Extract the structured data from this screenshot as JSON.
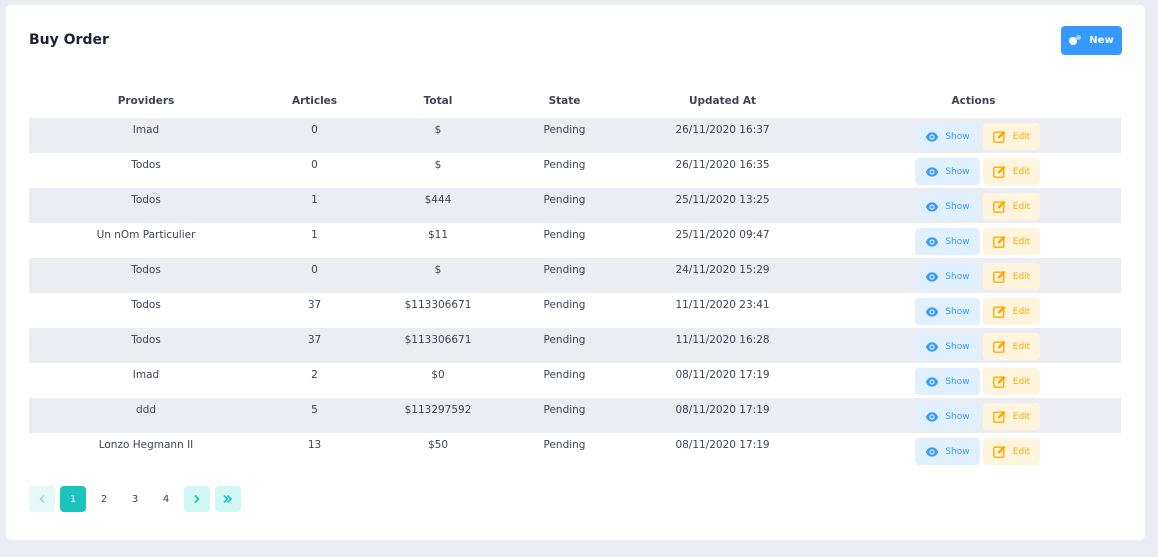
{
  "card": {
    "title": "Buy Order",
    "new_button_label": "New"
  },
  "table": {
    "headers": [
      "Providers",
      "Articles",
      "Total",
      "State",
      "Updated At",
      "Actions"
    ],
    "rows": [
      {
        "provider": "Imad",
        "articles": "0",
        "total": "$",
        "state": "Pending",
        "updated_at": "26/11/2020 16:37"
      },
      {
        "provider": "Todos",
        "articles": "0",
        "total": "$",
        "state": "Pending",
        "updated_at": "26/11/2020 16:35"
      },
      {
        "provider": "Todos",
        "articles": "1",
        "total": "$444",
        "state": "Pending",
        "updated_at": "25/11/2020 13:25"
      },
      {
        "provider": "Un nOm Particulier",
        "articles": "1",
        "total": "$11",
        "state": "Pending",
        "updated_at": "25/11/2020 09:47"
      },
      {
        "provider": "Todos",
        "articles": "0",
        "total": "$",
        "state": "Pending",
        "updated_at": "24/11/2020 15:29"
      },
      {
        "provider": "Todos",
        "articles": "37",
        "total": "$113306671",
        "state": "Pending",
        "updated_at": "11/11/2020 23:41"
      },
      {
        "provider": "Todos",
        "articles": "37",
        "total": "$113306671",
        "state": "Pending",
        "updated_at": "11/11/2020 16:28"
      },
      {
        "provider": "Imad",
        "articles": "2",
        "total": "$0",
        "state": "Pending",
        "updated_at": "08/11/2020 17:19"
      },
      {
        "provider": "ddd",
        "articles": "5",
        "total": "$113297592",
        "state": "Pending",
        "updated_at": "08/11/2020 17:19"
      },
      {
        "provider": "Lonzo Hegmann II",
        "articles": "13",
        "total": "$50",
        "state": "Pending",
        "updated_at": "08/11/2020 17:19"
      }
    ],
    "actions": {
      "show_label": "Show",
      "edit_label": "Edit",
      "show_icon": "eye-icon",
      "edit_icon": "edit-icon"
    }
  },
  "pagination": {
    "pages": [
      "1",
      "2",
      "3",
      "4"
    ],
    "current_page": "1",
    "prev_icon": "chevron-left-icon",
    "next_icon": "chevron-right-icon",
    "last_icon": "double-chevron-right-icon"
  },
  "colors": {
    "primary": "#3699ff",
    "success": "#1bc5bd",
    "warning": "#ffa800",
    "row_stripe": "#ebedf3"
  }
}
